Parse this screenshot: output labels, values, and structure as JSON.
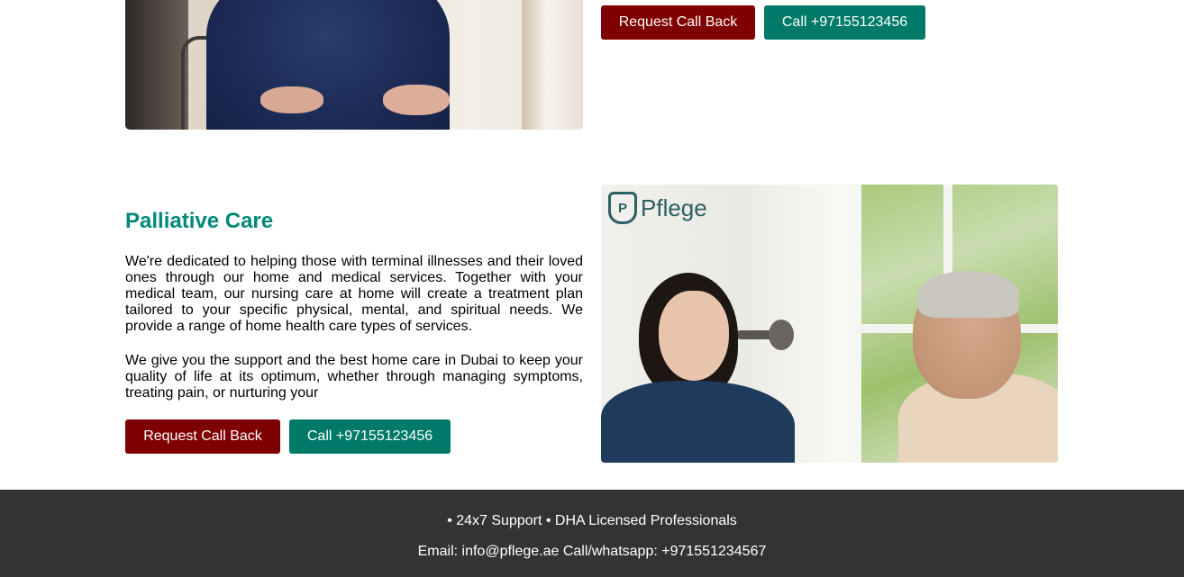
{
  "top_section": {
    "request_label": "Request Call Back",
    "call_label": "Call +97155123456"
  },
  "palliative": {
    "title": "Palliative Care",
    "para1": "We're dedicated to helping those with terminal illnesses and their loved ones through our home and medical services. Together with your medical team, our nursing care at home will create a treatment plan tailored to your specific physical, mental, and spiritual needs. We provide a range of home health care types of services.",
    "para2": "We give you the support and the best home care in Dubai to keep your quality of life at its optimum, whether through managing symptoms, treating pain, or nurturing your",
    "request_label": "Request Call Back",
    "call_label": "Call +97155123456",
    "image_logo_text": "Pflege"
  },
  "footer": {
    "line1": "• 24x7 Support • DHA Licensed Professionals",
    "line2": "Email: info@pflege.ae Call/whatsapp: +971551234567"
  },
  "colors": {
    "request_button": "#7f0000",
    "call_button": "#007a68",
    "title": "#00897b",
    "footer_bg": "#333333"
  }
}
